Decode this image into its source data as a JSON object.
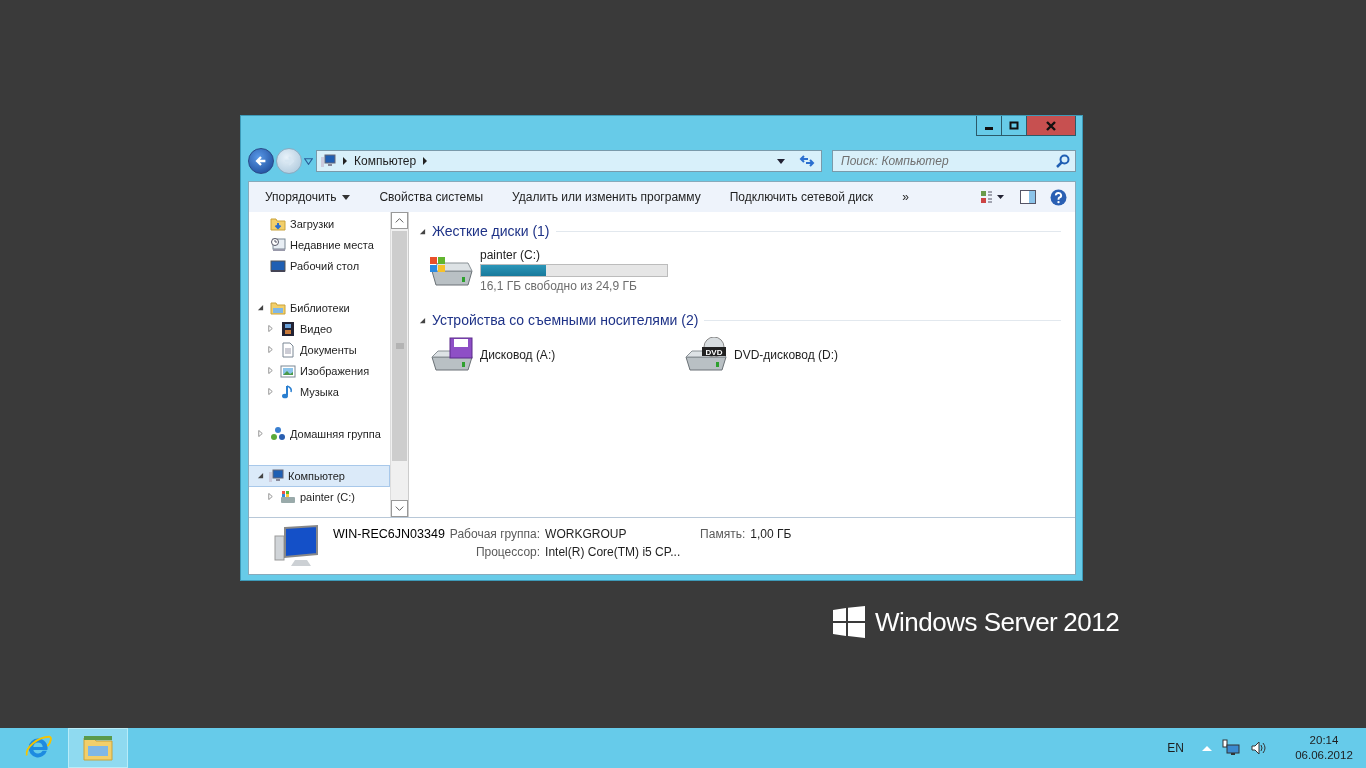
{
  "window": {
    "address": {
      "crumbs": [
        "Компьютер"
      ]
    },
    "search": {
      "placeholder": "Поиск: Компьютер"
    }
  },
  "toolbar": {
    "items": [
      {
        "label": "Упорядочить",
        "dropdown": true
      },
      {
        "label": "Свойства системы",
        "dropdown": false
      },
      {
        "label": "Удалить или изменить программу",
        "dropdown": false
      },
      {
        "label": "Подключить сетевой диск",
        "dropdown": false
      },
      {
        "label": "»",
        "dropdown": false
      }
    ]
  },
  "nav_tree": [
    {
      "items": [
        {
          "label": "Загрузки",
          "kind": "downloads"
        },
        {
          "label": "Недавние места",
          "kind": "recent"
        },
        {
          "label": "Рабочий стол",
          "kind": "desktop"
        }
      ]
    },
    {
      "items": [
        {
          "label": "Библиотеки",
          "kind": "libraries",
          "expanded": true,
          "selected": false,
          "children": [
            {
              "label": "Видео",
              "kind": "video",
              "expanded": false,
              "selected": false
            },
            {
              "label": "Документы",
              "kind": "documents",
              "expanded": false,
              "selected": false
            },
            {
              "label": "Изображения",
              "kind": "pictures",
              "expanded": false,
              "selected": false
            },
            {
              "label": "Музыка",
              "kind": "music",
              "expanded": false,
              "selected": false
            }
          ]
        }
      ]
    },
    {
      "items": [
        {
          "label": "Домашняя группа",
          "kind": "homegroup",
          "expanded": false,
          "selected": false
        }
      ]
    },
    {
      "items": [
        {
          "label": "Компьютер",
          "kind": "computer",
          "expanded": true,
          "selected": true,
          "children": [
            {
              "label": "painter (C:)",
              "kind": "drive",
              "expanded": false,
              "selected": false
            }
          ]
        }
      ]
    }
  ],
  "sections": [
    {
      "title": "Жесткие диски (1)",
      "expanded": true,
      "items": [
        {
          "name": "painter (C:)",
          "kind": "hdd",
          "level": 0.35,
          "space": "16,1 ГБ свободно из 24,9 ГБ"
        }
      ]
    },
    {
      "title": "Устройства со съемными носителями (2)",
      "expanded": true,
      "items": [
        {
          "name": "Дисковод (A:)",
          "kind": "floppy"
        },
        {
          "name": "DVD-дисковод (D:)",
          "kind": "dvd",
          "icon_label": "DVD"
        }
      ]
    }
  ],
  "details": {
    "computer_name": "WIN-REC6JN03349",
    "fields": [
      {
        "label": "Рабочая группа:",
        "value": "WORKGROUP"
      },
      {
        "label": "Память:",
        "value": "1,00 ГБ"
      },
      {
        "label": "Процессор:",
        "value": "Intel(R) Core(TM) i5 CP..."
      }
    ]
  },
  "logo": {
    "text": "Windows Server",
    "version": "2012"
  },
  "taskbar": {
    "apps": [
      {
        "kind": "ie",
        "selected": false
      },
      {
        "kind": "explorer",
        "selected": true
      }
    ],
    "language": "EN",
    "time": "20:14",
    "date": "06.06.2012"
  }
}
